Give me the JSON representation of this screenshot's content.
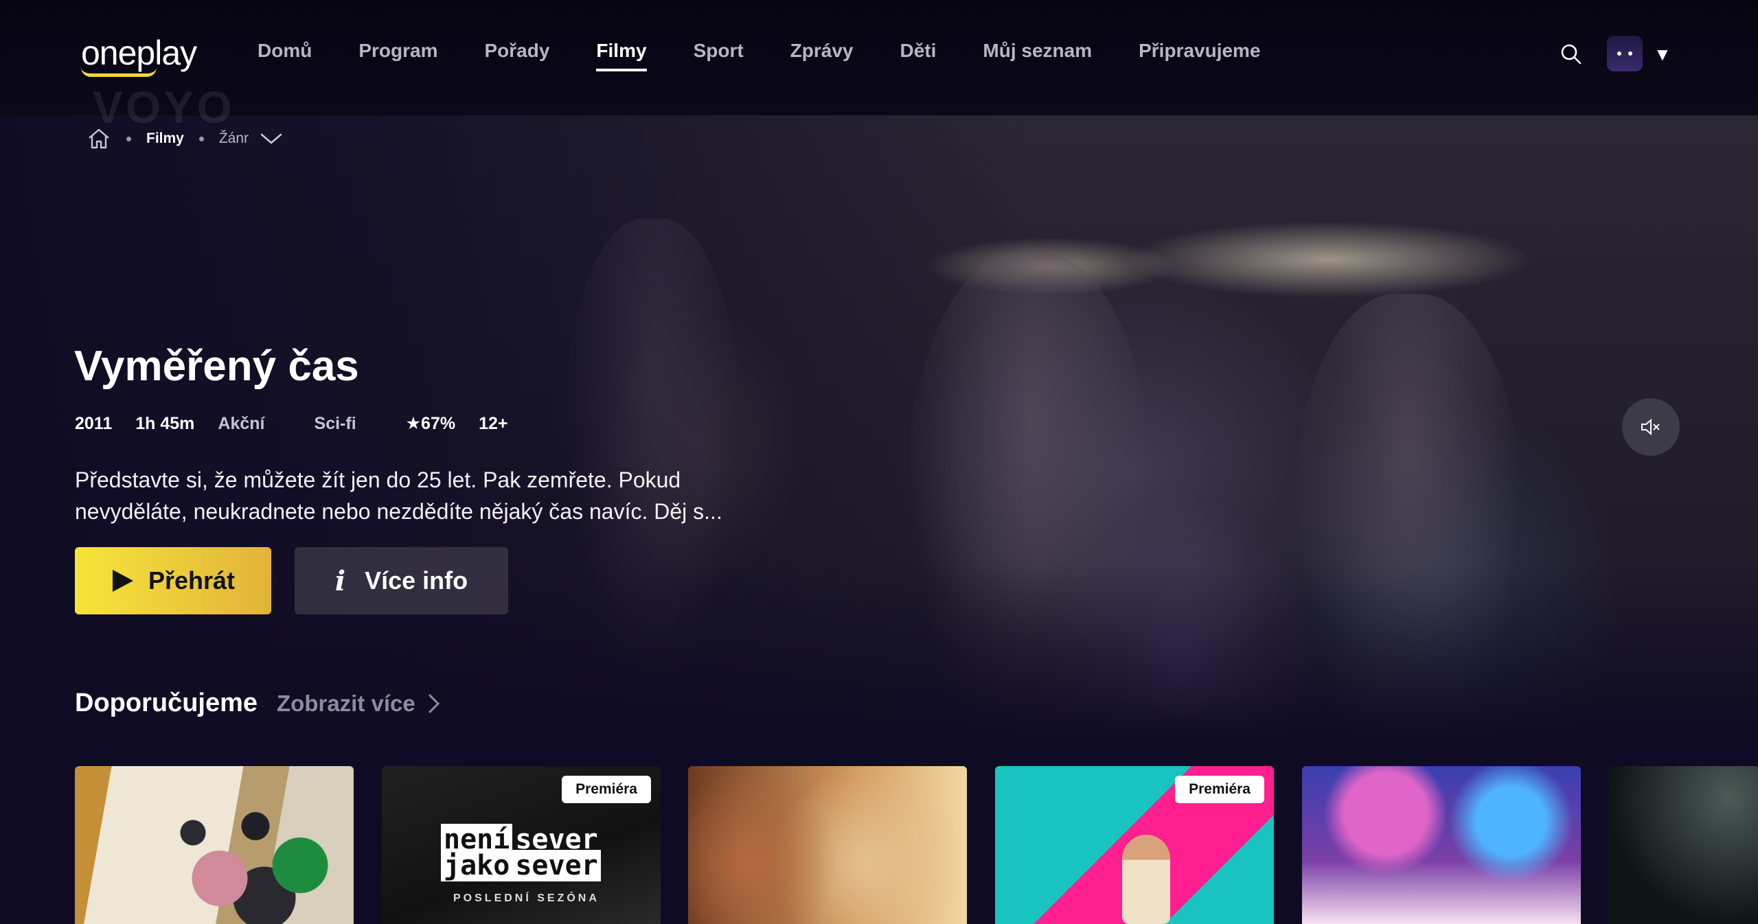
{
  "header": {
    "logo": "oneplay",
    "logo_ghost": "VOYO",
    "nav": [
      "Domů",
      "Program",
      "Pořady",
      "Filmy",
      "Sport",
      "Zprávy",
      "Děti",
      "Můj seznam",
      "Připravujeme"
    ],
    "active_nav": "Filmy",
    "icons": {
      "search": "search-icon",
      "profile": "avatar",
      "caret": "caret-down-icon"
    }
  },
  "breadcrumb": {
    "home_icon": "home-icon",
    "current": "Filmy",
    "genre": "Žánr"
  },
  "hero": {
    "title": "Vyměřený čas",
    "year": "2011",
    "duration": "1h 45m",
    "genres": [
      "Akční",
      "Sci-fi"
    ],
    "rating": "★67%",
    "age": "12+",
    "description": "Představte si, že můžete žít jen do 25 let. Pak zemřete. Pokud nevyděláte, neukradnete nebo nezdědíte nějaký čas navíc. Děj s...",
    "play_label": "Přehrát",
    "info_label": "Více info",
    "accent_color": "#f4d73d"
  },
  "recommended": {
    "title": "Doporučujeme",
    "more_label": "Zobrazit více",
    "cards": [
      {
        "badge": ""
      },
      {
        "badge": "Premiéra",
        "title_line1_a": "není",
        "title_line1_b": "sever",
        "title_line2_a": "jako",
        "title_line2_b": "sever",
        "subtitle": "POSLEDNÍ SEZÓNA"
      },
      {
        "badge": ""
      },
      {
        "badge": "Premiéra"
      },
      {
        "badge": ""
      },
      {
        "badge": ""
      }
    ]
  }
}
